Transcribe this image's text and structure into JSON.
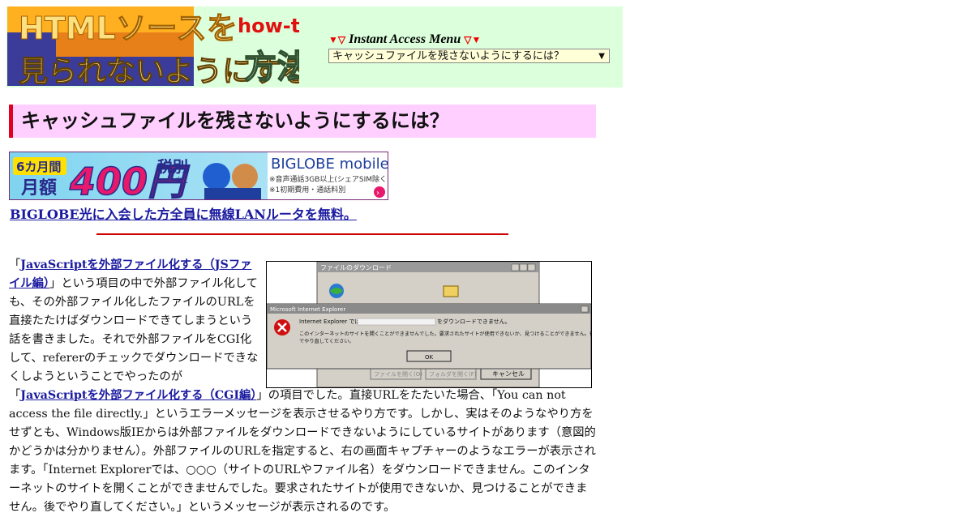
{
  "header": {
    "logo_line1": "HTMLソースを",
    "logo_line2": "見られないようにする",
    "logo_howto": "how-to",
    "logo_hoho": "方法",
    "menu_title": "Instant Access Menu",
    "menu_selected": "キャッシュファイルを残さないようにするには？"
  },
  "page_title": "キャッシュファイルを残さないようにするには？",
  "ad": {
    "months": "6カ月間",
    "monthly": "月額",
    "price": "400円",
    "tax": "税別",
    "note_mark": "※1",
    "brand": "BIGLOBE mobile",
    "note1": "※音声通話3GB以上(シェアSIM除く)",
    "note2": "※1初期費用・通話料別",
    "link_text": "BIGLOBE光に入会した方全員に無線LANルータを無料。"
  },
  "screenshot": {
    "download_title": "ファイルのダウンロード",
    "ie_title": "Microsoft Internet Explorer",
    "msg1_pre": "Internet Explorer では、",
    "msg1_post": "をダウンロードできません。",
    "msg2": "このインターネットのサイトを開くことができませんでした。要求されたサイトが使用できないか、見つけることができません。後",
    "msg3": "でやり直してください。",
    "ok": "OK",
    "btn_open_file": "ファイルを開く(O)",
    "btn_open_folder": "フォルダを開く(F)",
    "btn_cancel": "キャンセル"
  },
  "body": {
    "p1_a": "「",
    "p1_link1": "JavaScriptを外部ファイル化する（JSファイル編）",
    "p1_b": "」という項目の中で外部ファイル化しても、その外部ファイル化したファイルのURLを直接たたけばダウンロードできてしまうという話を書きました。それで外部ファイルをCGI化して、refererのチェックでダウンロードできなくしようということでやったのが「",
    "p1_link2": "JavaScriptを外部ファイル化する（CGI編）",
    "p1_c": "」の項目でした。直接URLをたたいた場合、「You can not access the file directly.」というエラーメッセージを表示させるやり方です。しかし、実はそのようなやり方をせずとも、Windows版IEからは外部ファイルをダウンロードできないようにしているサイトがあります（意図的かどうかは分かりません）。外部ファイルのURLを指定すると、右の画面キャプチャーのようなエラーが表示されます。「Internet Explorerでは、○○○（サイトのURLやファイル名）をダウンロードできません。このインターネットのサイトを開くことができませんでした。要求されたサイトが使用できないか、見つけることができません。後でやり直してください。」というメッセージが表示されるのです。"
  }
}
